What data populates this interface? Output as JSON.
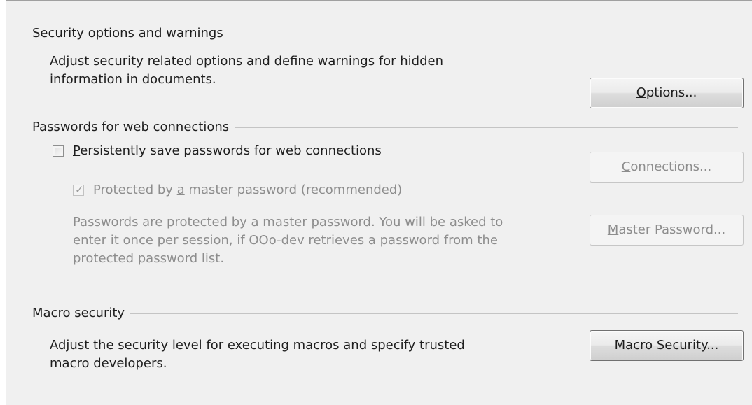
{
  "sections": {
    "security": {
      "title": "Security options and warnings",
      "description_line1": "Adjust security related options and define warnings for hidden",
      "description_line2": "information in documents.",
      "options_button": {
        "mnemonic": "O",
        "rest": "ptions..."
      }
    },
    "passwords": {
      "title": "Passwords for web connections",
      "persist_checkbox": {
        "checked": false,
        "mnemonic": "P",
        "rest": "ersistently save passwords for web connections"
      },
      "connections_button": {
        "mnemonic": "C",
        "rest": "onnections...",
        "enabled": false
      },
      "master_checkbox": {
        "checked": true,
        "enabled": false,
        "before": "Protected by ",
        "mnemonic": "a",
        "after": " master password (recommended)"
      },
      "master_description_line1": "Passwords are protected by a master password. You will be asked to",
      "master_description_line2": "enter it once per session, if OOo-dev retrieves a password from the",
      "master_description_line3": "protected password list.",
      "master_password_button": {
        "mnemonic": "M",
        "rest": "aster Password...",
        "enabled": false
      }
    },
    "macro": {
      "title": "Macro security",
      "description_line1": "Adjust the security level for executing macros and specify trusted",
      "description_line2": "macro developers.",
      "macro_security_button": {
        "before": "Macro ",
        "mnemonic": "S",
        "rest": "ecurity..."
      }
    }
  },
  "icons": {
    "checkmark": "check-icon"
  },
  "colors": {
    "panel_background": "#f0f0f0",
    "disabled_text": "#8d8d8d",
    "separator": "#c4c4c4"
  }
}
